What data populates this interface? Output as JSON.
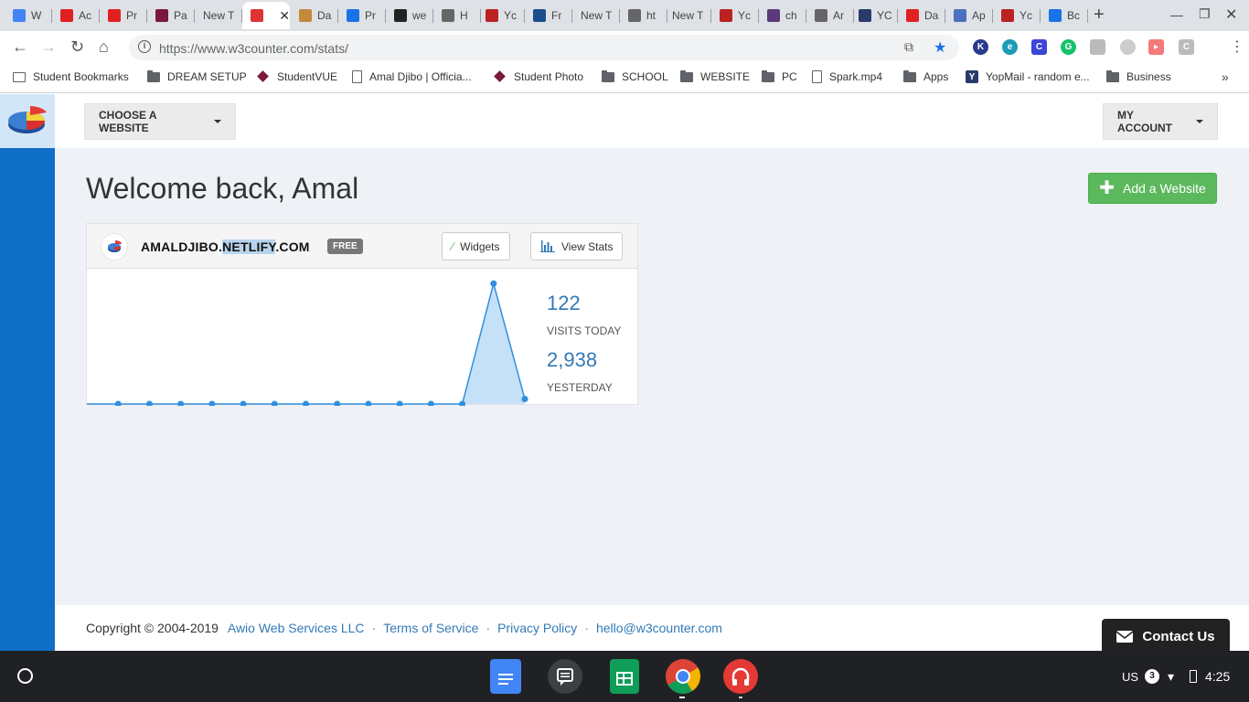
{
  "browser": {
    "tabs": [
      {
        "title": "W",
        "favicon": "docs-icon",
        "color": "#4285f4"
      },
      {
        "title": "Ac",
        "favicon": "adobe-icon",
        "color": "#e02020"
      },
      {
        "title": "Pr",
        "favicon": "adobe-icon",
        "color": "#e02020"
      },
      {
        "title": "Pa",
        "favicon": "studentvue-icon",
        "color": "#7a1a3a"
      },
      {
        "title": "New T",
        "favicon": "",
        "color": ""
      },
      {
        "title": "",
        "favicon": "w3counter-icon",
        "color": "#d33",
        "active": true
      },
      {
        "title": "Da",
        "favicon": "monkey-icon",
        "color": "#c48a3a"
      },
      {
        "title": "Pr",
        "favicon": "drive-icon",
        "color": "#1a73e8"
      },
      {
        "title": "we",
        "favicon": "github-icon",
        "color": "#222"
      },
      {
        "title": "H",
        "favicon": "doc-icon",
        "color": "#666"
      },
      {
        "title": "Yc",
        "favicon": "shield-icon",
        "color": "#b22"
      },
      {
        "title": "Fr",
        "favicon": "dollar-icon",
        "color": "#1a4f8b"
      },
      {
        "title": "New T",
        "favicon": "",
        "color": ""
      },
      {
        "title": "ht",
        "favicon": "doc-icon",
        "color": "#666"
      },
      {
        "title": "New T",
        "favicon": "",
        "color": ""
      },
      {
        "title": "Yc",
        "favicon": "shield-icon",
        "color": "#b22"
      },
      {
        "title": "ch",
        "favicon": "image-icon",
        "color": "#5b3a7a"
      },
      {
        "title": "Ar",
        "favicon": "doc-icon",
        "color": "#666"
      },
      {
        "title": "YC",
        "favicon": "yopmail-icon",
        "color": "#2a3a6a"
      },
      {
        "title": "Da",
        "favicon": "adobe-icon",
        "color": "#e02020"
      },
      {
        "title": "Ap",
        "favicon": "globe-icon",
        "color": "#4c6fbf"
      },
      {
        "title": "Yc",
        "favicon": "shield-icon",
        "color": "#b22"
      },
      {
        "title": "Bc",
        "favicon": "star-icon",
        "color": "#1a73e8"
      }
    ],
    "url_base": "https://www.w3counter.com",
    "url_path": "/stats/",
    "bookmarks": [
      {
        "label": "Student Bookmarks",
        "icon": "bookmarks-icon"
      },
      {
        "label": "DREAM SETUP",
        "icon": "folder-icon"
      },
      {
        "label": "StudentVUE",
        "icon": "studentvue-icon"
      },
      {
        "label": "Amal Djibo | Officia...",
        "icon": "doc-icon"
      },
      {
        "label": "Student Photo",
        "icon": "studentvue-icon"
      },
      {
        "label": "SCHOOL",
        "icon": "folder-icon"
      },
      {
        "label": "WEBSITE",
        "icon": "folder-icon"
      },
      {
        "label": "PC",
        "icon": "folder-icon"
      },
      {
        "label": "Spark.mp4",
        "icon": "doc-icon"
      },
      {
        "label": "Apps",
        "icon": "folder-icon"
      },
      {
        "label": "YopMail - random e...",
        "icon": "yopmail-icon"
      },
      {
        "label": "Business",
        "icon": "folder-icon"
      }
    ],
    "overflow_label": "»"
  },
  "header": {
    "choose_website": "CHOOSE A WEBSITE",
    "my_account": "MY ACCOUNT"
  },
  "main": {
    "welcome": "Welcome back, Amal",
    "add_website": "Add a Website",
    "site": {
      "name_pre": "AMALDJIBO.",
      "name_hl": "NETLIFY",
      "name_post": ".COM",
      "plan": "FREE",
      "widgets_label": "Widgets",
      "view_stats_label": "View Stats",
      "visits_today": "122",
      "visits_today_label": "VISITS TODAY",
      "yesterday": "2,938",
      "yesterday_label": "YESTERDAY"
    }
  },
  "chart_data": {
    "type": "area",
    "x": [
      1,
      2,
      3,
      4,
      5,
      6,
      7,
      8,
      9,
      10,
      11,
      12,
      13,
      14,
      15
    ],
    "values": [
      0,
      0,
      0,
      0,
      0,
      0,
      0,
      0,
      0,
      0,
      0,
      0,
      0,
      2938,
      122
    ],
    "ylim": [
      0,
      3300
    ],
    "color": "#2f8fe0",
    "fill": "#c5e1f7"
  },
  "footer": {
    "copyright": "Copyright © 2004-2019",
    "company": "Awio Web Services LLC",
    "terms": "Terms of Service",
    "privacy": "Privacy Policy",
    "email": "hello@w3counter.com",
    "contact": "Contact Us"
  },
  "system": {
    "locale": "US",
    "notifications": "3",
    "time": "4:25"
  }
}
